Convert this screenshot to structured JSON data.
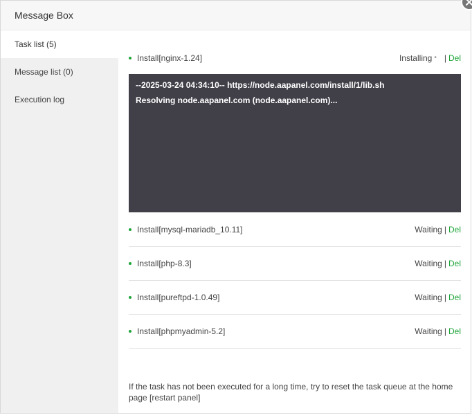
{
  "dialog": {
    "title": "Message Box",
    "close_icon": "close-icon"
  },
  "sidebar": {
    "items": [
      {
        "label": "Task list (5)",
        "active": true
      },
      {
        "label": "Message list (0)",
        "active": false
      },
      {
        "label": "Execution log",
        "active": false
      }
    ]
  },
  "tasks": [
    {
      "name": "Install[nginx-1.24]",
      "status": "Installing",
      "del": "Del"
    },
    {
      "name": "Install[mysql-mariadb_10.11]",
      "status": "Waiting",
      "del": "Del"
    },
    {
      "name": "Install[php-8.3]",
      "status": "Waiting",
      "del": "Del"
    },
    {
      "name": "Install[pureftpd-1.0.49]",
      "status": "Waiting",
      "del": "Del"
    },
    {
      "name": "Install[phpmyadmin-5.2]",
      "status": "Waiting",
      "del": "Del"
    }
  ],
  "separator": "|",
  "spinner": "•",
  "console": {
    "lines": [
      "--2025-03-24 04:34:10-- https://node.aapanel.com/install/1/lib.sh",
      "Resolving node.aapanel.com (node.aapanel.com)..."
    ]
  },
  "footer_note": "If the task has not been executed for a long time, try to reset the task queue at the home page [restart panel]",
  "colors": {
    "accent": "#20a53a",
    "console_bg": "#414049",
    "sidebar_bg": "#f0f0f0"
  }
}
